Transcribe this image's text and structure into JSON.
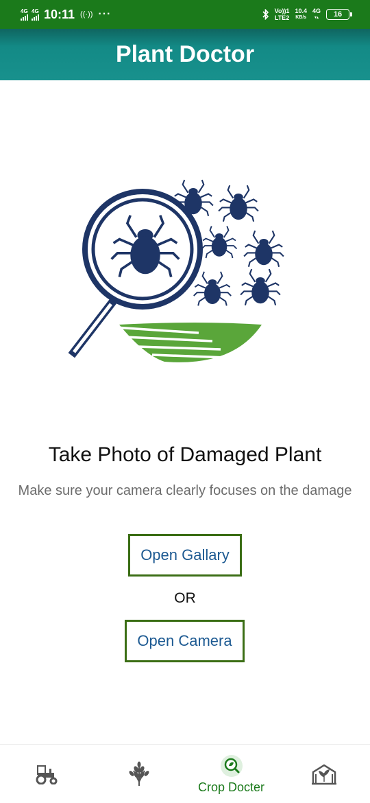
{
  "status_bar": {
    "sim1_network": "4G",
    "sim2_network": "4G",
    "time": "10:11",
    "hotspot_icon": "((·))",
    "more": "···",
    "bluetooth_icon": "bluetooth-icon",
    "volte_top": "Vo))1",
    "volte_bottom": "LTE2",
    "speed_value": "10.4",
    "speed_unit": "KB/s",
    "data_network": "4G",
    "battery": "16"
  },
  "header": {
    "title": "Plant Doctor"
  },
  "main": {
    "headline": "Take Photo of Damaged Plant",
    "subline": "Make sure your camera clearly focuses on the damage",
    "open_gallery": "Open Gallary",
    "or_text": "OR",
    "open_camera": "Open Camera"
  },
  "bottom_nav": {
    "items": [
      {
        "icon": "tractor-icon",
        "label": ""
      },
      {
        "icon": "wheat-icon",
        "label": ""
      },
      {
        "icon": "magnifier-leaf-icon",
        "label": "Crop Docter"
      },
      {
        "icon": "greenhouse-icon",
        "label": ""
      }
    ]
  },
  "colors": {
    "status_bar": "#1b7a1b",
    "header": "#18918d",
    "button_border": "#3b6e15",
    "button_text": "#1d5a92",
    "bug": "#1e3566",
    "leaf": "#5aa63a"
  }
}
